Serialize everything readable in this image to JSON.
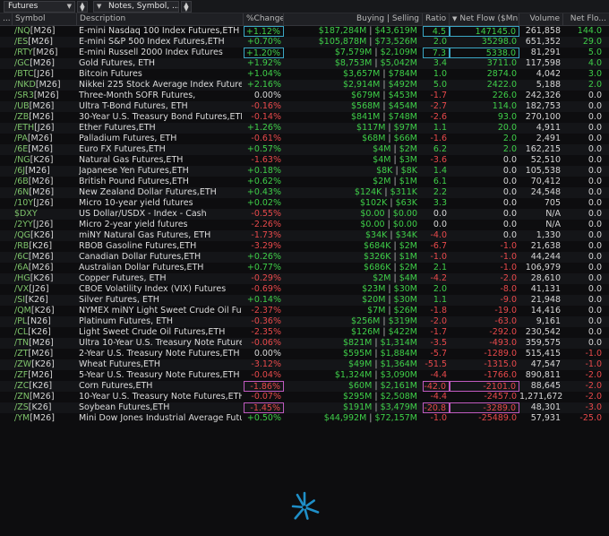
{
  "toolbar": {
    "watchlist": "Futures",
    "notes_field": "Notes, Symbol, ..."
  },
  "columns": {
    "menu": "...",
    "symbol": "Symbol",
    "description": "Description",
    "pct_change": "%Change",
    "buying_selling": "Buying | Selling",
    "ratio": "Ratio",
    "net_flow": "Net Flow ($Mn)",
    "volume": "Volume",
    "net_flow_short": "Net Flo..."
  },
  "colors": {
    "positive": "#3fcf49",
    "negative": "#e8494b",
    "highlight_cyan": "#3aa6c4",
    "highlight_magenta": "#c05ac0",
    "logo": "#1f8fc8"
  },
  "rows": [
    {
      "sym": "/NQ",
      "code": "[M26]",
      "desc": "E-mini Nasdaq 100 Index Futures,ETH",
      "chg": "+1.12%",
      "buy": "$187,284M",
      "sell": "$43,619M",
      "ratio": "4.5",
      "flow": "147145.0",
      "vol": "261,858",
      "nf": "144.0",
      "box_chg": true,
      "box_ratio": true,
      "box_flow": true
    },
    {
      "sym": "/ES",
      "code": "[M26]",
      "desc": "E-mini S&P 500 Index Futures,ETH",
      "chg": "+0.70%",
      "buy": "$105,878M",
      "sell": "$73,526M",
      "ratio": "2.0",
      "flow": "35298.0",
      "vol": "651,352",
      "nf": "29.0"
    },
    {
      "sym": "/RTY",
      "code": "[M26]",
      "desc": "E-mini Russell 2000 Index Futures",
      "chg": "+1.20%",
      "buy": "$7,579M",
      "sell": "$2,109M",
      "ratio": "7.3",
      "flow": "5338.0",
      "vol": "81,291",
      "nf": "5.0",
      "box_chg": true,
      "box_ratio": true,
      "box_flow": true
    },
    {
      "sym": "/GC",
      "code": "[M26]",
      "desc": "Gold Futures, ETH",
      "chg": "+1.92%",
      "buy": "$8,753M",
      "sell": "$5,042M",
      "ratio": "3.4",
      "flow": "3711.0",
      "vol": "117,598",
      "nf": "4.0"
    },
    {
      "sym": "/BTC",
      "code": "[J26]",
      "desc": "Bitcoin Futures",
      "chg": "+1.04%",
      "buy": "$3,657M",
      "sell": "$784M",
      "ratio": "1.0",
      "flow": "2874.0",
      "vol": "4,042",
      "nf": "3.0"
    },
    {
      "sym": "/NKD",
      "code": "[M26]",
      "desc": "Nikkei 225 Stock Average Index Futures,ETH",
      "chg": "+2.16%",
      "buy": "$2,914M",
      "sell": "$492M",
      "ratio": "5.0",
      "flow": "2422.0",
      "vol": "5,188",
      "nf": "2.0"
    },
    {
      "sym": "/SR3",
      "code": "[M26]",
      "desc": "Three-Month SOFR Futures,",
      "chg": "0.00%",
      "buy": "$679M",
      "sell": "$453M",
      "ratio": "-1.7",
      "flow": "226.0",
      "vol": "242,326",
      "nf": "0.0"
    },
    {
      "sym": "/UB",
      "code": "[M26]",
      "desc": "Ultra T-Bond Futures, ETH",
      "chg": "-0.16%",
      "buy": "$568M",
      "sell": "$454M",
      "ratio": "-2.7",
      "flow": "114.0",
      "vol": "182,753",
      "nf": "0.0"
    },
    {
      "sym": "/ZB",
      "code": "[M26]",
      "desc": "30-Year U.S. Treasury Bond Futures,ETH",
      "chg": "-0.14%",
      "buy": "$841M",
      "sell": "$748M",
      "ratio": "-2.6",
      "flow": "93.0",
      "vol": "270,100",
      "nf": "0.0"
    },
    {
      "sym": "/ETH",
      "code": "[J26]",
      "desc": "Ether Futures,ETH",
      "chg": "+1.26%",
      "buy": "$117M",
      "sell": "$97M",
      "ratio": "1.1",
      "flow": "20.0",
      "vol": "4,911",
      "nf": "0.0"
    },
    {
      "sym": "/PA",
      "code": "[M26]",
      "desc": "Palladium Futures, ETH",
      "chg": "-0.61%",
      "buy": "$68M",
      "sell": "$66M",
      "ratio": "-1.6",
      "flow": "2.0",
      "vol": "2,491",
      "nf": "0.0"
    },
    {
      "sym": "/6E",
      "code": "[M26]",
      "desc": "Euro FX Futures,ETH",
      "chg": "+0.57%",
      "buy": "$4M",
      "sell": "$2M",
      "ratio": "6.2",
      "flow": "2.0",
      "vol": "162,215",
      "nf": "0.0"
    },
    {
      "sym": "/NG",
      "code": "[K26]",
      "desc": "Natural Gas Futures,ETH",
      "chg": "-1.63%",
      "buy": "$4M",
      "sell": "$3M",
      "ratio": "-3.6",
      "flow": "0.0",
      "vol": "52,510",
      "nf": "0.0"
    },
    {
      "sym": "/6J",
      "code": "[M26]",
      "desc": "Japanese Yen Futures,ETH",
      "chg": "+0.18%",
      "buy": "$8K",
      "sell": "$8K",
      "ratio": "1.4",
      "flow": "0.0",
      "vol": "105,538",
      "nf": "0.0"
    },
    {
      "sym": "/6B",
      "code": "[M26]",
      "desc": "British Pound Futures,ETH",
      "chg": "+0.62%",
      "buy": "$2M",
      "sell": "$1M",
      "ratio": "6.1",
      "flow": "0.0",
      "vol": "70,412",
      "nf": "0.0"
    },
    {
      "sym": "/6N",
      "code": "[M26]",
      "desc": "New Zealand Dollar Futures,ETH",
      "chg": "+0.43%",
      "buy": "$124K",
      "sell": "$311K",
      "ratio": "2.2",
      "flow": "0.0",
      "vol": "24,548",
      "nf": "0.0"
    },
    {
      "sym": "/10Y",
      "code": "[J26]",
      "desc": "Micro 10-year yield futures",
      "chg": "+0.02%",
      "buy": "$102K",
      "sell": "$63K",
      "ratio": "3.3",
      "flow": "0.0",
      "vol": "705",
      "nf": "0.0"
    },
    {
      "sym": "$DXY",
      "code": "",
      "desc": "US Dollar/USDX - Index - Cash",
      "chg": "-0.55%",
      "buy": "$0.00",
      "sell": "$0.00",
      "ratio": "0.0",
      "flow": "0.0",
      "vol": "N/A",
      "nf": "0.0"
    },
    {
      "sym": "/2YY",
      "code": "[J26]",
      "desc": "Micro 2-year yield futures",
      "chg": "-2.26%",
      "buy": "$0.00",
      "sell": "$0.00",
      "ratio": "0.0",
      "flow": "0.0",
      "vol": "N/A",
      "nf": "0.0"
    },
    {
      "sym": "/QG",
      "code": "[K26]",
      "desc": "miNY Natural Gas Futures, ETH",
      "chg": "-1.73%",
      "buy": "$34K",
      "sell": "$34K",
      "ratio": "-4.0",
      "flow": "0.0",
      "vol": "1,330",
      "nf": "0.0"
    },
    {
      "sym": "/RB",
      "code": "[K26]",
      "desc": "RBOB Gasoline Futures,ETH",
      "chg": "-3.29%",
      "buy": "$684K",
      "sell": "$2M",
      "ratio": "-6.7",
      "flow": "-1.0",
      "vol": "21,638",
      "nf": "0.0"
    },
    {
      "sym": "/6C",
      "code": "[M26]",
      "desc": "Canadian Dollar Futures,ETH",
      "chg": "+0.26%",
      "buy": "$326K",
      "sell": "$1M",
      "ratio": "-1.0",
      "flow": "-1.0",
      "vol": "44,244",
      "nf": "0.0"
    },
    {
      "sym": "/6A",
      "code": "[M26]",
      "desc": "Australian Dollar Futures,ETH",
      "chg": "+0.77%",
      "buy": "$686K",
      "sell": "$2M",
      "ratio": "2.1",
      "flow": "-1.0",
      "vol": "106,979",
      "nf": "0.0"
    },
    {
      "sym": "/HG",
      "code": "[K26]",
      "desc": "Copper Futures, ETH",
      "chg": "-0.29%",
      "buy": "$2M",
      "sell": "$4M",
      "ratio": "-4.2",
      "flow": "-2.0",
      "vol": "28,610",
      "nf": "0.0"
    },
    {
      "sym": "/VX",
      "code": "[J26]",
      "desc": "CBOE Volatility Index (VIX) Futures",
      "chg": "-0.69%",
      "buy": "$23M",
      "sell": "$30M",
      "ratio": "2.0",
      "flow": "-8.0",
      "vol": "41,131",
      "nf": "0.0"
    },
    {
      "sym": "/SI",
      "code": "[K26]",
      "desc": "Silver Futures, ETH",
      "chg": "+0.14%",
      "buy": "$20M",
      "sell": "$30M",
      "ratio": "1.1",
      "flow": "-9.0",
      "vol": "21,948",
      "nf": "0.0"
    },
    {
      "sym": "/QM",
      "code": "[K26]",
      "desc": "NYMEX miNY Light Sweet Crude Oil Future...",
      "chg": "-2.37%",
      "buy": "$7M",
      "sell": "$26M",
      "ratio": "-1.8",
      "flow": "-19.0",
      "vol": "14,416",
      "nf": "0.0"
    },
    {
      "sym": "/PL",
      "code": "[N26]",
      "desc": "Platinum Futures, ETH",
      "chg": "-0.36%",
      "buy": "$256M",
      "sell": "$319M",
      "ratio": "-2.0",
      "flow": "-63.0",
      "vol": "9,161",
      "nf": "0.0"
    },
    {
      "sym": "/CL",
      "code": "[K26]",
      "desc": "Light Sweet Crude Oil Futures,ETH",
      "chg": "-2.35%",
      "buy": "$126M",
      "sell": "$422M",
      "ratio": "-1.7",
      "flow": "-292.0",
      "vol": "230,542",
      "nf": "0.0"
    },
    {
      "sym": "/TN",
      "code": "[M26]",
      "desc": "Ultra 10-Year U.S. Treasury Note Futures",
      "chg": "-0.06%",
      "buy": "$821M",
      "sell": "$1,314M",
      "ratio": "-3.5",
      "flow": "-493.0",
      "vol": "359,575",
      "nf": "0.0"
    },
    {
      "sym": "/ZT",
      "code": "[M26]",
      "desc": "2-Year U.S. Treasury Note Futures,ETH",
      "chg": "0.00%",
      "buy": "$595M",
      "sell": "$1,884M",
      "ratio": "-5.7",
      "flow": "-1289.0",
      "vol": "515,415",
      "nf": "-1.0"
    },
    {
      "sym": "/ZW",
      "code": "[K26]",
      "desc": "Wheat Futures,ETH",
      "chg": "-3.12%",
      "buy": "$49M",
      "sell": "$1,364M",
      "ratio": "-51.5",
      "flow": "-1315.0",
      "vol": "47,547",
      "nf": "-1.0"
    },
    {
      "sym": "/ZF",
      "code": "[M26]",
      "desc": "5-Year U.S. Treasury Note Futures,ETH",
      "chg": "-0.04%",
      "buy": "$1,324M",
      "sell": "$3,090M",
      "ratio": "-4.4",
      "flow": "-1766.0",
      "vol": "890,811",
      "nf": "-2.0"
    },
    {
      "sym": "/ZC",
      "code": "[K26]",
      "desc": "Corn Futures,ETH",
      "chg": "-1.86%",
      "buy": "$60M",
      "sell": "$2,161M",
      "ratio": "-42.0",
      "flow": "-2101.0",
      "vol": "88,645",
      "nf": "-2.0",
      "box_chg_m": true,
      "box_ratio_m": true,
      "box_flow_m": true
    },
    {
      "sym": "/ZN",
      "code": "[M26]",
      "desc": "10-Year U.S. Treasury Note Futures,ETH",
      "chg": "-0.07%",
      "buy": "$295M",
      "sell": "$2,508M",
      "ratio": "-4.4",
      "flow": "-2457.0",
      "vol": "1,271,672",
      "nf": "-2.0"
    },
    {
      "sym": "/ZS",
      "code": "[K26]",
      "desc": "Soybean Futures,ETH",
      "chg": "-1.45%",
      "buy": "$191M",
      "sell": "$3,479M",
      "ratio": "-20.8",
      "flow": "-3289.0",
      "vol": "48,301",
      "nf": "-3.0",
      "box_chg_m": true,
      "box_ratio_m": true,
      "box_flow_m": true
    },
    {
      "sym": "/YM",
      "code": "[M26]",
      "desc": "Mini Dow Jones Industrial Average Future...",
      "chg": "+0.50%",
      "buy": "$44,992M",
      "sell": "$72,157M",
      "ratio": "-1.0",
      "flow": "-25489.0",
      "vol": "57,931",
      "nf": "-25.0"
    }
  ]
}
